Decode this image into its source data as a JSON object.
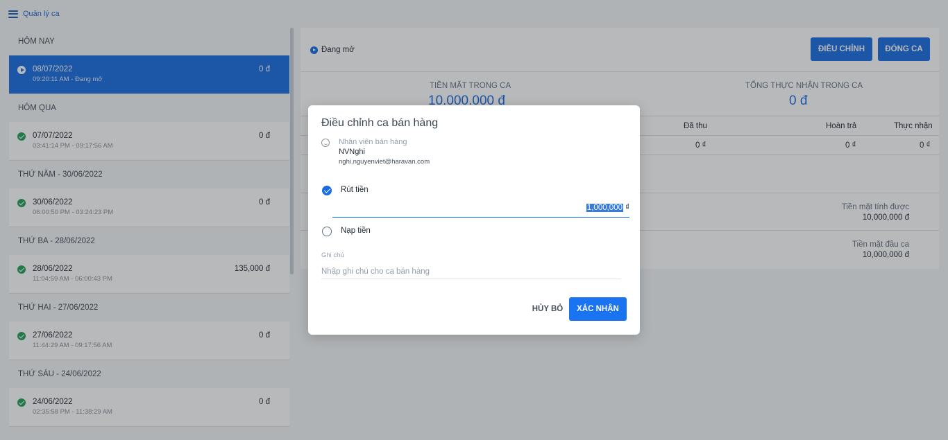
{
  "topbar": {
    "title": "Quản lý ca"
  },
  "sidebar": {
    "groups": [
      {
        "header": "HÔM NAY",
        "items": [
          {
            "date": "08/07/2022",
            "time": "09:20:11 AM - Đang mở",
            "amount": "0 đ"
          }
        ]
      },
      {
        "header": "HÔM QUA",
        "items": [
          {
            "date": "07/07/2022",
            "time": "03:41:14 PM - 09:17:56 AM",
            "amount": "0 đ"
          }
        ]
      },
      {
        "header": "THỨ NĂM - 30/06/2022",
        "items": [
          {
            "date": "30/06/2022",
            "time": "06:00:50 PM - 03:24:23 PM",
            "amount": "0 đ"
          }
        ]
      },
      {
        "header": "THỨ BA - 28/06/2022",
        "items": [
          {
            "date": "28/06/2022",
            "time": "11:04:59 AM - 06:00:43 PM",
            "amount": "135,000 đ"
          }
        ]
      },
      {
        "header": "THỨ HAI - 27/06/2022",
        "items": [
          {
            "date": "27/06/2022",
            "time": "11:44:29 AM - 09:17:56 AM",
            "amount": "0 đ"
          }
        ]
      },
      {
        "header": "THỨ SÁU - 24/06/2022",
        "items": [
          {
            "date": "24/06/2022",
            "time": "02:35:58 PM - 11:38:29 AM",
            "amount": "0 đ"
          }
        ]
      }
    ]
  },
  "main": {
    "status": "Đang mở",
    "adjust_label": "ĐIỀU CHỈNH",
    "close_label": "ĐÓNG CA",
    "cash_in_shift_label": "TIỀN MẶT TRONG CA",
    "cash_in_shift_value": "10.000.000 đ",
    "total_received_label": "TỔNG THỰC NHẬN TRONG CA",
    "total_received_value": "0 đ",
    "table_headers": {
      "collected": "Đã thu",
      "refunded": "Hoàn trả",
      "received": "Thực nhận"
    },
    "table_row": {
      "collected": "0 ₫",
      "refunded": "0 ₫",
      "received": "0 ₫"
    },
    "cash_calculated_label": "Tiền mặt tính được",
    "cash_calculated_value": "10,000,000 đ",
    "cash_start_label": "Tiền mặt đầu ca",
    "cash_start_value": "10,000,000 đ"
  },
  "dialog": {
    "title": "Điều chỉnh ca bán hàng",
    "staff_label": "Nhân viên bán hàng",
    "staff_name": "NVNghi",
    "staff_email": "nghi.nguyenviet@haravan.com",
    "withdraw_label": "Rút tiền",
    "amount_value": "1,000,000",
    "currency": "₫",
    "deposit_label": "Nạp tiền",
    "note_label": "Ghi chú",
    "note_placeholder": "Nhập ghi chú cho ca bán hàng",
    "cancel_label": "HỦY BỎ",
    "confirm_label": "XÁC NHẬN"
  }
}
